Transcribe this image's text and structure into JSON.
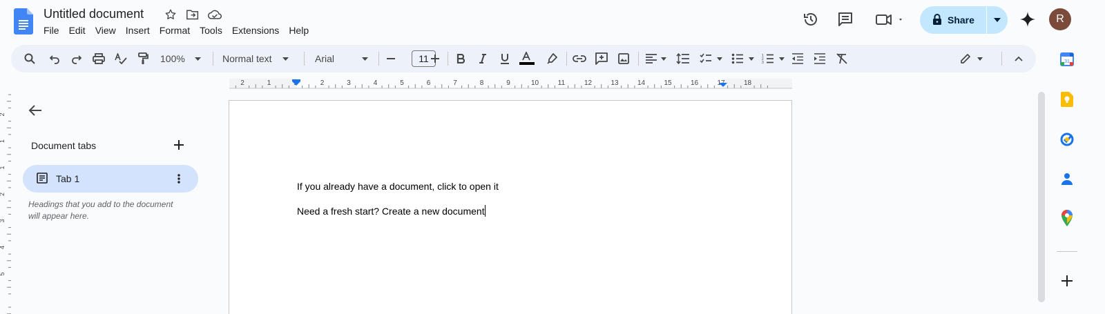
{
  "document": {
    "title": "Untitled document"
  },
  "menu": {
    "items": [
      "File",
      "Edit",
      "View",
      "Insert",
      "Format",
      "Tools",
      "Extensions",
      "Help"
    ]
  },
  "header": {
    "share_label": "Share",
    "avatar_initial": "R",
    "icons": [
      "star-icon",
      "move-to-folder-icon",
      "cloud-saved-icon",
      "version-history-icon",
      "comments-icon",
      "meet-icon",
      "gemini-icon"
    ]
  },
  "toolbar": {
    "zoom": "100%",
    "style": "Normal text",
    "font": "Arial",
    "font_size": "11",
    "icons": [
      "search-icon",
      "undo-icon",
      "redo-icon",
      "print-icon",
      "spellcheck-icon",
      "paint-format-icon",
      "bold-icon",
      "italic-icon",
      "underline-icon",
      "text-color-icon",
      "highlight-icon",
      "link-icon",
      "comment-add-icon",
      "image-icon",
      "align-icon",
      "line-spacing-icon",
      "checklist-icon",
      "bullet-list-icon",
      "numbered-list-icon",
      "indent-decrease-icon",
      "indent-increase-icon",
      "clear-format-icon",
      "editing-mode-icon",
      "collapse-icon"
    ]
  },
  "ruler": {
    "labels": [
      "2",
      "1",
      "1",
      "2",
      "3",
      "4",
      "5",
      "6",
      "7",
      "8",
      "9",
      "10",
      "11",
      "12",
      "13",
      "14",
      "15",
      "16",
      "17",
      "18"
    ]
  },
  "vruler": {
    "labels": [
      "2",
      "1",
      "1",
      "2",
      "3",
      "4",
      "5"
    ]
  },
  "sidebar": {
    "title": "Document tabs",
    "tabs": [
      {
        "label": "Tab 1"
      }
    ],
    "hint": "Headings that you add to the document will appear here."
  },
  "page": {
    "line1": "If you already have a document, click to open it",
    "line2": "Need a fresh start? Create a new document"
  },
  "side_panel": {
    "icons": [
      "calendar-icon",
      "keep-icon",
      "tasks-icon",
      "contacts-icon",
      "maps-icon",
      "add-addon-icon"
    ]
  },
  "colors": {
    "accent": "#0b57d0",
    "share_bg": "#c2e7ff",
    "toolbar_bg": "#edf2fa",
    "tab_selected": "#d3e3fd",
    "background": "#f9fbfd"
  }
}
